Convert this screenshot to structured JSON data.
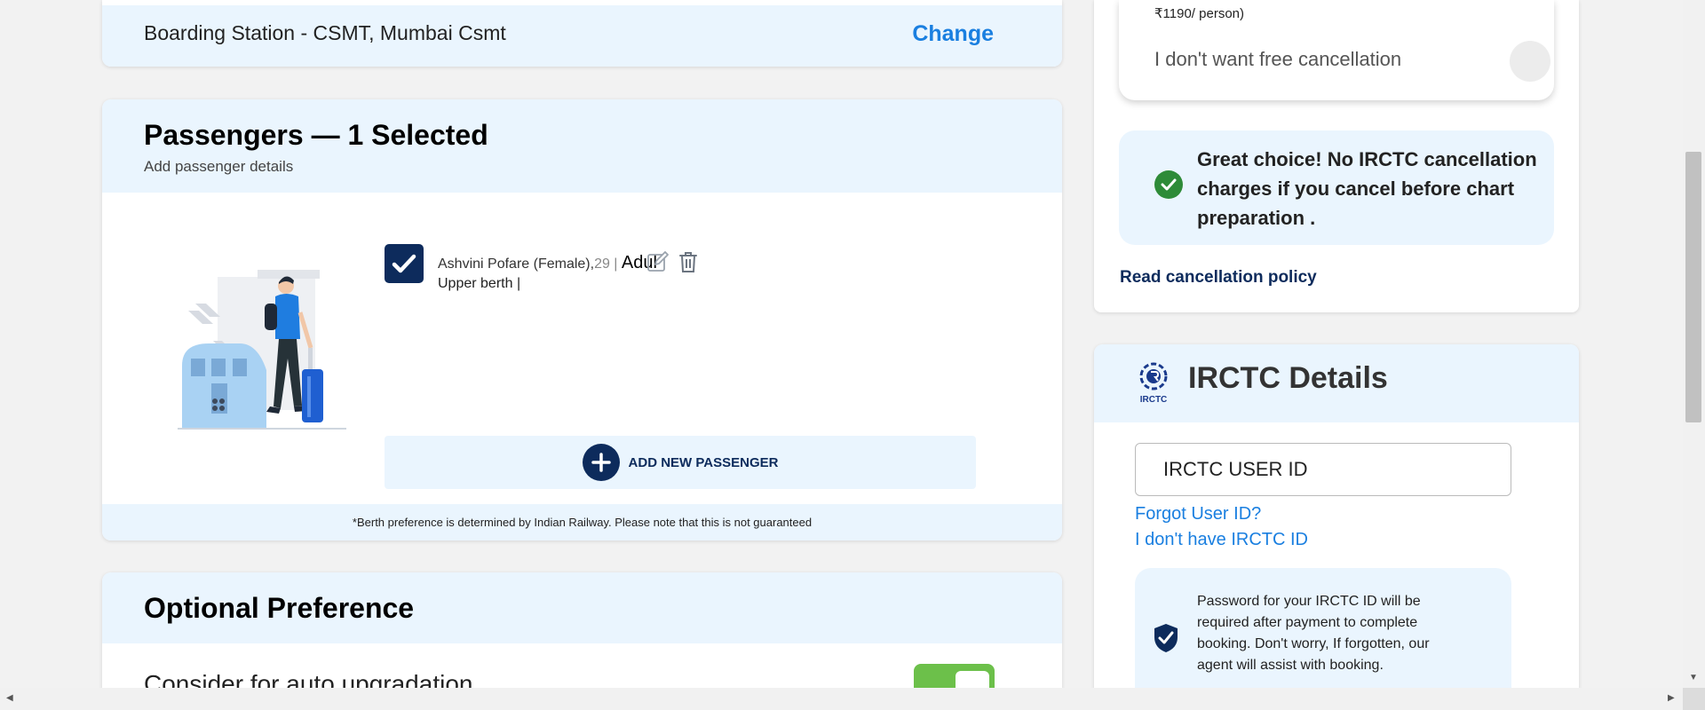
{
  "boarding": {
    "text": "Boarding Station - CSMT, Mumbai Csmt",
    "change_label": "Change"
  },
  "passengers": {
    "title": "Passengers — 1 Selected",
    "subtitle": "Add passenger details",
    "list": [
      {
        "name_gender": "Ashvini Pofare (Female),",
        "age": "29 |",
        "type": "Adul",
        "berth": "Upper berth |",
        "selected": true
      }
    ],
    "add_label": "ADD NEW PASSENGER",
    "berth_note": "*Berth preference is determined by Indian Railway. Please note that this is not guaranteed"
  },
  "optional": {
    "title": "Optional Preference",
    "auto_upgrade_label": "Consider for auto upgradation",
    "toggle_color": "#6cc04a"
  },
  "cancellation": {
    "price": "₹1190/ person)",
    "no_option": "I don't want free cancellation",
    "great_choice": "Great choice! No IRCTC cancellation charges if you cancel before chart preparation .",
    "policy_link": "Read cancellation policy"
  },
  "irctc": {
    "logo_text": "IRCTC",
    "title": "IRCTC Details",
    "user_id_placeholder": "IRCTC USER ID",
    "forgot_link": "Forgot User ID?",
    "no_id_link": "I don't have IRCTC ID",
    "password_note": "Password for your IRCTC ID will be required after payment to complete booking. Don't worry, If forgotten, our agent will assist with booking."
  },
  "colors": {
    "accent": "#1a7fe0",
    "navy": "#0d2b5c",
    "band": "#eaf5fe",
    "success": "#2e8b38"
  }
}
